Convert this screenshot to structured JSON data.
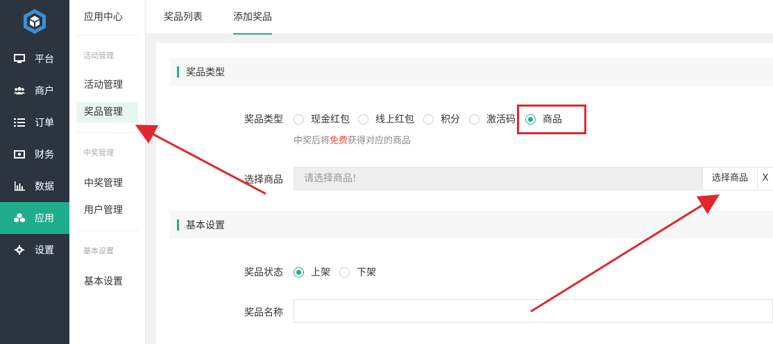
{
  "nav": {
    "items": [
      {
        "label": "平台",
        "icon": "monitor-icon"
      },
      {
        "label": "商户",
        "icon": "users-icon"
      },
      {
        "label": "订单",
        "icon": "list-icon"
      },
      {
        "label": "财务",
        "icon": "money-icon"
      },
      {
        "label": "数据",
        "icon": "bar-chart-icon"
      },
      {
        "label": "应用",
        "icon": "cubes-icon",
        "active": true
      },
      {
        "label": "设置",
        "icon": "gear-icon"
      }
    ]
  },
  "subnav": {
    "head": "应用中心",
    "groups": [
      {
        "title": "活动管理",
        "items": [
          "活动管理",
          "奖品管理"
        ]
      },
      {
        "title": "中奖管理",
        "items": [
          "中奖管理",
          "用户管理"
        ]
      },
      {
        "title": "基本设置",
        "items": [
          "基本设置"
        ]
      }
    ],
    "active_item": "奖品管理"
  },
  "tabs": [
    "奖品列表",
    "添加奖品"
  ],
  "active_tab": "添加奖品",
  "form": {
    "section1_title": "奖品类型",
    "prize_type_label": "奖品类型",
    "prize_types": [
      "现金红包",
      "线上红包",
      "积分",
      "激活码",
      "商品"
    ],
    "prize_type_selected": "商品",
    "hint_before": "中奖后将",
    "hint_red": "免费",
    "hint_after": "获得对应的商品",
    "select_goods_label": "选择商品",
    "select_goods_placeholder": "请选择商品!",
    "select_goods_button": "选择商品",
    "clear_button": "X",
    "section2_title": "基本设置",
    "status_label": "奖品状态",
    "status_options": [
      "上架",
      "下架"
    ],
    "status_selected": "上架",
    "name_label": "奖品名称",
    "name_value": ""
  },
  "colors": {
    "accent": "#1fae8d",
    "sidebar_bg": "#2c3440",
    "annotation_red": "#e3262d"
  }
}
